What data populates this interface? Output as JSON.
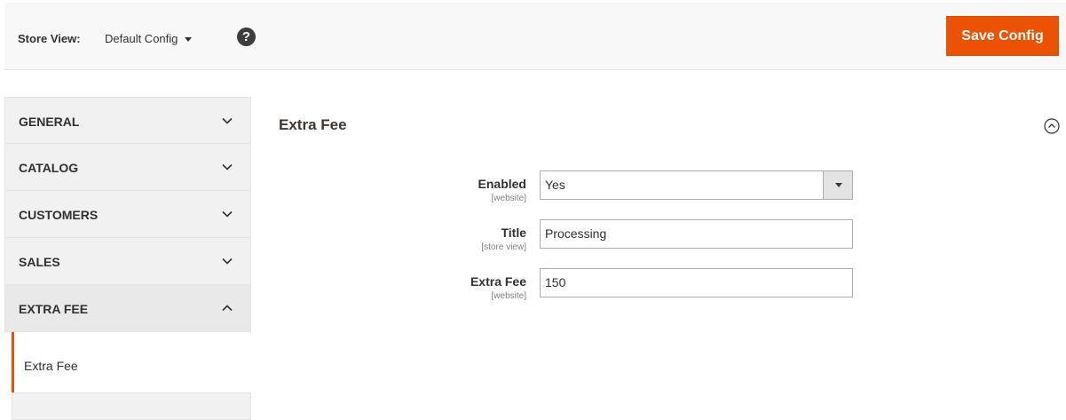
{
  "header": {
    "store_view_label": "Store View:",
    "store_view_value": "Default Config",
    "help_glyph": "?",
    "save_label": "Save Config",
    "accent_color": "#eb5202"
  },
  "sidebar": {
    "items": [
      {
        "label": "GENERAL",
        "state": "collapsed"
      },
      {
        "label": "CATALOG",
        "state": "collapsed"
      },
      {
        "label": "CUSTOMERS",
        "state": "collapsed"
      },
      {
        "label": "SALES",
        "state": "collapsed"
      },
      {
        "label": "EXTRA FEE",
        "state": "expanded"
      }
    ],
    "subitem": {
      "label": "Extra Fee",
      "active": true
    }
  },
  "section": {
    "title": "Extra Fee",
    "fields": [
      {
        "label": "Enabled",
        "scope": "[website]",
        "type": "select",
        "value": "Yes"
      },
      {
        "label": "Title",
        "scope": "[store view]",
        "type": "text",
        "value": "Processing"
      },
      {
        "label": "Extra Fee",
        "scope": "[website]",
        "type": "text",
        "value": "150"
      }
    ]
  }
}
